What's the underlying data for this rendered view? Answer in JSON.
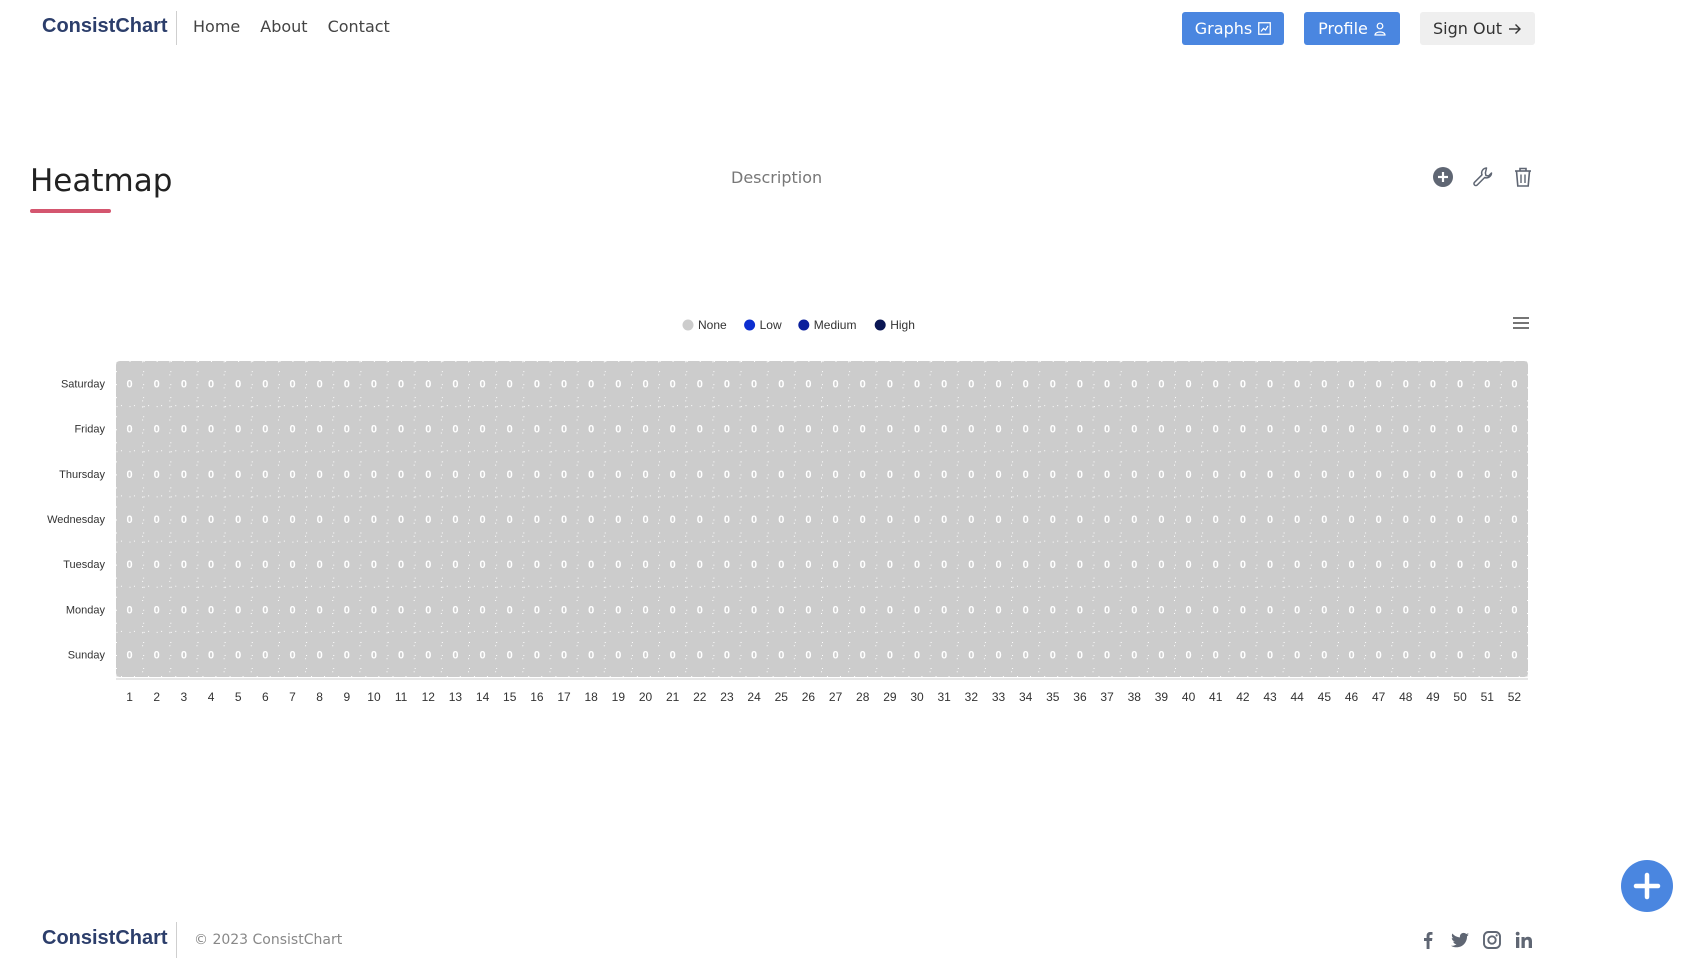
{
  "header": {
    "brand": "ConsistChart",
    "nav": [
      "Home",
      "About",
      "Contact"
    ],
    "graphs_label": "Graphs",
    "profile_label": "Profile",
    "signout_label": "Sign Out"
  },
  "page": {
    "title": "Heatmap",
    "description": "Description"
  },
  "footer": {
    "brand": "ConsistChart",
    "copyright": "© 2023 ConsistChart"
  },
  "colors": {
    "accent": "#4a86e0",
    "title_underline": "#d4566f",
    "cell": "#cccccc"
  },
  "chart_data": {
    "type": "heatmap",
    "title": "",
    "xlabel": "",
    "ylabel": "",
    "legend_position": "top-center",
    "legend": [
      {
        "name": "None",
        "color": "#cccccc"
      },
      {
        "name": "Low",
        "color": "#0c2ed0"
      },
      {
        "name": "Medium",
        "color": "#0a1f9c"
      },
      {
        "name": "High",
        "color": "#0a1654"
      }
    ],
    "y_categories": [
      "Saturday",
      "Friday",
      "Thursday",
      "Wednesday",
      "Tuesday",
      "Monday",
      "Sunday"
    ],
    "x_categories": [
      "1",
      "2",
      "3",
      "4",
      "5",
      "6",
      "7",
      "8",
      "9",
      "10",
      "11",
      "12",
      "13",
      "14",
      "15",
      "16",
      "17",
      "18",
      "19",
      "20",
      "21",
      "22",
      "23",
      "24",
      "25",
      "26",
      "27",
      "28",
      "29",
      "30",
      "31",
      "32",
      "33",
      "34",
      "35",
      "36",
      "37",
      "38",
      "39",
      "40",
      "41",
      "42",
      "43",
      "44",
      "45",
      "46",
      "47",
      "48",
      "49",
      "50",
      "51",
      "52"
    ],
    "values": [
      [
        0,
        0,
        0,
        0,
        0,
        0,
        0,
        0,
        0,
        0,
        0,
        0,
        0,
        0,
        0,
        0,
        0,
        0,
        0,
        0,
        0,
        0,
        0,
        0,
        0,
        0,
        0,
        0,
        0,
        0,
        0,
        0,
        0,
        0,
        0,
        0,
        0,
        0,
        0,
        0,
        0,
        0,
        0,
        0,
        0,
        0,
        0,
        0,
        0,
        0,
        0,
        0
      ],
      [
        0,
        0,
        0,
        0,
        0,
        0,
        0,
        0,
        0,
        0,
        0,
        0,
        0,
        0,
        0,
        0,
        0,
        0,
        0,
        0,
        0,
        0,
        0,
        0,
        0,
        0,
        0,
        0,
        0,
        0,
        0,
        0,
        0,
        0,
        0,
        0,
        0,
        0,
        0,
        0,
        0,
        0,
        0,
        0,
        0,
        0,
        0,
        0,
        0,
        0,
        0,
        0
      ],
      [
        0,
        0,
        0,
        0,
        0,
        0,
        0,
        0,
        0,
        0,
        0,
        0,
        0,
        0,
        0,
        0,
        0,
        0,
        0,
        0,
        0,
        0,
        0,
        0,
        0,
        0,
        0,
        0,
        0,
        0,
        0,
        0,
        0,
        0,
        0,
        0,
        0,
        0,
        0,
        0,
        0,
        0,
        0,
        0,
        0,
        0,
        0,
        0,
        0,
        0,
        0,
        0
      ],
      [
        0,
        0,
        0,
        0,
        0,
        0,
        0,
        0,
        0,
        0,
        0,
        0,
        0,
        0,
        0,
        0,
        0,
        0,
        0,
        0,
        0,
        0,
        0,
        0,
        0,
        0,
        0,
        0,
        0,
        0,
        0,
        0,
        0,
        0,
        0,
        0,
        0,
        0,
        0,
        0,
        0,
        0,
        0,
        0,
        0,
        0,
        0,
        0,
        0,
        0,
        0,
        0
      ],
      [
        0,
        0,
        0,
        0,
        0,
        0,
        0,
        0,
        0,
        0,
        0,
        0,
        0,
        0,
        0,
        0,
        0,
        0,
        0,
        0,
        0,
        0,
        0,
        0,
        0,
        0,
        0,
        0,
        0,
        0,
        0,
        0,
        0,
        0,
        0,
        0,
        0,
        0,
        0,
        0,
        0,
        0,
        0,
        0,
        0,
        0,
        0,
        0,
        0,
        0,
        0,
        0
      ],
      [
        0,
        0,
        0,
        0,
        0,
        0,
        0,
        0,
        0,
        0,
        0,
        0,
        0,
        0,
        0,
        0,
        0,
        0,
        0,
        0,
        0,
        0,
        0,
        0,
        0,
        0,
        0,
        0,
        0,
        0,
        0,
        0,
        0,
        0,
        0,
        0,
        0,
        0,
        0,
        0,
        0,
        0,
        0,
        0,
        0,
        0,
        0,
        0,
        0,
        0,
        0,
        0
      ],
      [
        0,
        0,
        0,
        0,
        0,
        0,
        0,
        0,
        0,
        0,
        0,
        0,
        0,
        0,
        0,
        0,
        0,
        0,
        0,
        0,
        0,
        0,
        0,
        0,
        0,
        0,
        0,
        0,
        0,
        0,
        0,
        0,
        0,
        0,
        0,
        0,
        0,
        0,
        0,
        0,
        0,
        0,
        0,
        0,
        0,
        0,
        0,
        0,
        0,
        0,
        0,
        0
      ]
    ]
  }
}
